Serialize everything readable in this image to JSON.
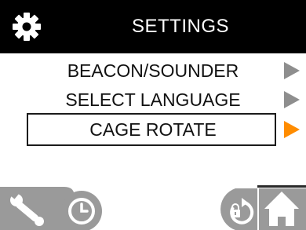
{
  "header": {
    "title": "SETTINGS",
    "icon": "gear-icon"
  },
  "menu": {
    "items": [
      {
        "label": "BEACON/SOUNDER",
        "selected": false
      },
      {
        "label": "SELECT LANGUAGE",
        "selected": false
      },
      {
        "label": "CAGE ROTATE",
        "selected": true
      }
    ]
  },
  "softkeys": {
    "left": [
      {
        "icon": "wrench-icon"
      },
      {
        "icon": "clock-icon"
      }
    ],
    "right": [
      {
        "icon": "lock-rotate-icon"
      },
      {
        "icon": "home-icon"
      }
    ]
  },
  "colors": {
    "header_bg": "#000000",
    "accent": "#ff8c00",
    "arrow_inactive": "#8e8e8e",
    "softkey": "#9a9a9a"
  }
}
